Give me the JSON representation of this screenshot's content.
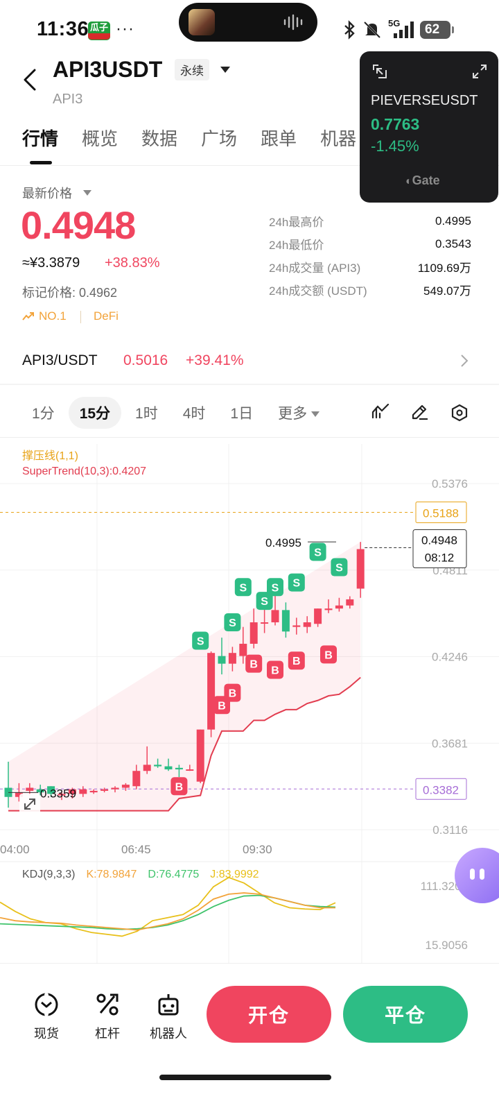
{
  "status": {
    "time": "11:36",
    "app_badge": "瓜子",
    "dots": "···",
    "network": "5G",
    "battery": "62"
  },
  "header": {
    "title": "API3USDT",
    "tag": "永续",
    "subtitle": "API3"
  },
  "tabs": [
    "行情",
    "概览",
    "数据",
    "广场",
    "跟单",
    "机器"
  ],
  "floating": {
    "symbol": "PIEVERSEUSDT",
    "price": "0.7763",
    "change": "-1.45%",
    "brand": "Gate"
  },
  "price": {
    "label": "最新价格",
    "last": "0.4948",
    "cny": "≈¥3.3879",
    "change": "+38.83%",
    "mark": "标记价格: 0.4962",
    "rank": "NO.1",
    "sector": "DeFi"
  },
  "stats": [
    {
      "k": "24h最高价",
      "v": "0.4995"
    },
    {
      "k": "24h最低价",
      "v": "0.3543"
    },
    {
      "k": "24h成交量 (API3)",
      "v": "1109.69万"
    },
    {
      "k": "24h成交额 (USDT)",
      "v": "549.07万"
    }
  ],
  "spot": {
    "pair": "API3/USDT",
    "price": "0.5016",
    "change": "+39.41%"
  },
  "timeframes": [
    "1分",
    "15分",
    "1时",
    "4时",
    "1日",
    "更多"
  ],
  "active_timeframe": "15分",
  "indicators": {
    "line1": "撑压线(1,1)",
    "line2": "SuperTrend(10,3):0.4207"
  },
  "kdj": {
    "label": "KDJ(9,3,3)",
    "k": "K:78.9847",
    "d": "D:76.4775",
    "j": "J:83.9992",
    "high": "111.3205",
    "low": "15.9056"
  },
  "colors": {
    "up": "#2dbd85",
    "down": "#f0455f",
    "k_line": "#f2a33a",
    "d_line": "#3fc36b",
    "j_line": "#e8c01a",
    "supertrend": "#e23c4f"
  },
  "bottom": {
    "spot": "现货",
    "leverage": "杠杆",
    "bot": "机器人",
    "open": "开仓",
    "close": "平仓"
  },
  "chart_data": {
    "type": "candlestick",
    "ylim": [
      0.3116,
      0.5376
    ],
    "y_ticks": [
      "0.5376",
      "0.4811",
      "0.4246",
      "0.3681",
      "0.3116"
    ],
    "x_ticks": [
      "04:00",
      "06:45",
      "09:30"
    ],
    "resistance": "0.5188",
    "support": "0.3382",
    "current_price": "0.4948",
    "countdown": "08:12",
    "high_marker": "0.4995",
    "low_marker": "0.3359",
    "candles": [
      [
        0.339,
        0.356,
        0.326,
        0.333
      ],
      [
        0.333,
        0.342,
        0.33,
        0.336
      ],
      [
        0.337,
        0.342,
        0.334,
        0.339
      ],
      [
        0.338,
        0.341,
        0.334,
        0.336
      ],
      [
        0.34,
        0.34,
        0.333,
        0.335
      ],
      [
        0.334,
        0.336,
        0.331,
        0.335
      ],
      [
        0.335,
        0.339,
        0.332,
        0.338
      ],
      [
        0.335,
        0.34,
        0.333,
        0.338
      ],
      [
        0.336,
        0.338,
        0.335,
        0.337
      ],
      [
        0.337,
        0.339,
        0.336,
        0.338
      ],
      [
        0.338,
        0.34,
        0.336,
        0.339
      ],
      [
        0.339,
        0.342,
        0.337,
        0.341
      ],
      [
        0.34,
        0.354,
        0.338,
        0.35
      ],
      [
        0.35,
        0.366,
        0.348,
        0.354
      ],
      [
        0.354,
        0.358,
        0.352,
        0.353
      ],
      [
        0.353,
        0.358,
        0.35,
        0.351
      ],
      [
        0.352,
        0.354,
        0.346,
        0.351
      ],
      [
        0.351,
        0.354,
        0.35,
        0.351
      ],
      [
        0.343,
        0.377,
        0.342,
        0.377
      ],
      [
        0.377,
        0.428,
        0.372,
        0.427
      ],
      [
        0.425,
        0.437,
        0.413,
        0.42
      ],
      [
        0.42,
        0.431,
        0.415,
        0.427
      ],
      [
        0.425,
        0.444,
        0.42,
        0.433
      ],
      [
        0.433,
        0.456,
        0.43,
        0.447
      ],
      [
        0.447,
        0.456,
        0.44,
        0.447
      ],
      [
        0.447,
        0.468,
        0.445,
        0.455
      ],
      [
        0.455,
        0.46,
        0.437,
        0.441
      ],
      [
        0.444,
        0.45,
        0.439,
        0.445
      ],
      [
        0.444,
        0.451,
        0.44,
        0.447
      ],
      [
        0.446,
        0.456,
        0.444,
        0.456
      ],
      [
        0.455,
        0.462,
        0.453,
        0.456
      ],
      [
        0.456,
        0.463,
        0.454,
        0.458
      ],
      [
        0.458,
        0.464,
        0.456,
        0.462
      ],
      [
        0.469,
        0.4995,
        0.463,
        0.4948
      ]
    ],
    "trades": [
      {
        "type": "B",
        "candle": 16,
        "price": 0.34
      },
      {
        "type": "B",
        "candle": 20,
        "price": 0.393
      },
      {
        "type": "B",
        "candle": 21,
        "price": 0.401
      },
      {
        "type": "B",
        "candle": 23,
        "price": 0.42
      },
      {
        "type": "B",
        "candle": 25,
        "price": 0.416
      },
      {
        "type": "B",
        "candle": 27,
        "price": 0.422
      },
      {
        "type": "B",
        "candle": 30,
        "price": 0.426
      },
      {
        "type": "S",
        "candle": 18,
        "price": 0.435
      },
      {
        "type": "S",
        "candle": 21,
        "price": 0.447
      },
      {
        "type": "S",
        "candle": 22,
        "price": 0.47
      },
      {
        "type": "S",
        "candle": 24,
        "price": 0.461
      },
      {
        "type": "S",
        "candle": 25,
        "price": 0.47
      },
      {
        "type": "S",
        "candle": 27,
        "price": 0.473
      },
      {
        "type": "S",
        "candle": 29,
        "price": 0.493
      },
      {
        "type": "S",
        "candle": 31,
        "price": 0.483
      }
    ],
    "supertrend": [
      0.324,
      0.324,
      0.324,
      0.324,
      0.324,
      0.324,
      0.324,
      0.324,
      0.324,
      0.324,
      0.324,
      0.324,
      0.324,
      0.324,
      0.324,
      0.324,
      0.332,
      0.333,
      0.334,
      0.36,
      0.376,
      0.376,
      0.376,
      0.383,
      0.383,
      0.387,
      0.39,
      0.39,
      0.394,
      0.396,
      0.399,
      0.4,
      0.405,
      0.411
    ],
    "kdj_series": {
      "k": [
        60,
        55,
        53,
        52,
        51,
        48,
        46,
        44,
        42,
        40,
        45,
        50,
        58,
        72,
        90,
        98,
        100,
        98,
        92,
        86,
        80,
        76,
        76
      ],
      "d": [
        50,
        49,
        48,
        47,
        46,
        45,
        44,
        42,
        41,
        42,
        44,
        48,
        55,
        65,
        78,
        88,
        95,
        96,
        92,
        86,
        80,
        78,
        77
      ],
      "j": [
        85,
        70,
        58,
        52,
        50,
        42,
        36,
        33,
        30,
        38,
        55,
        60,
        65,
        80,
        110,
        125,
        116,
        100,
        84,
        76,
        74,
        73,
        84
      ]
    }
  }
}
